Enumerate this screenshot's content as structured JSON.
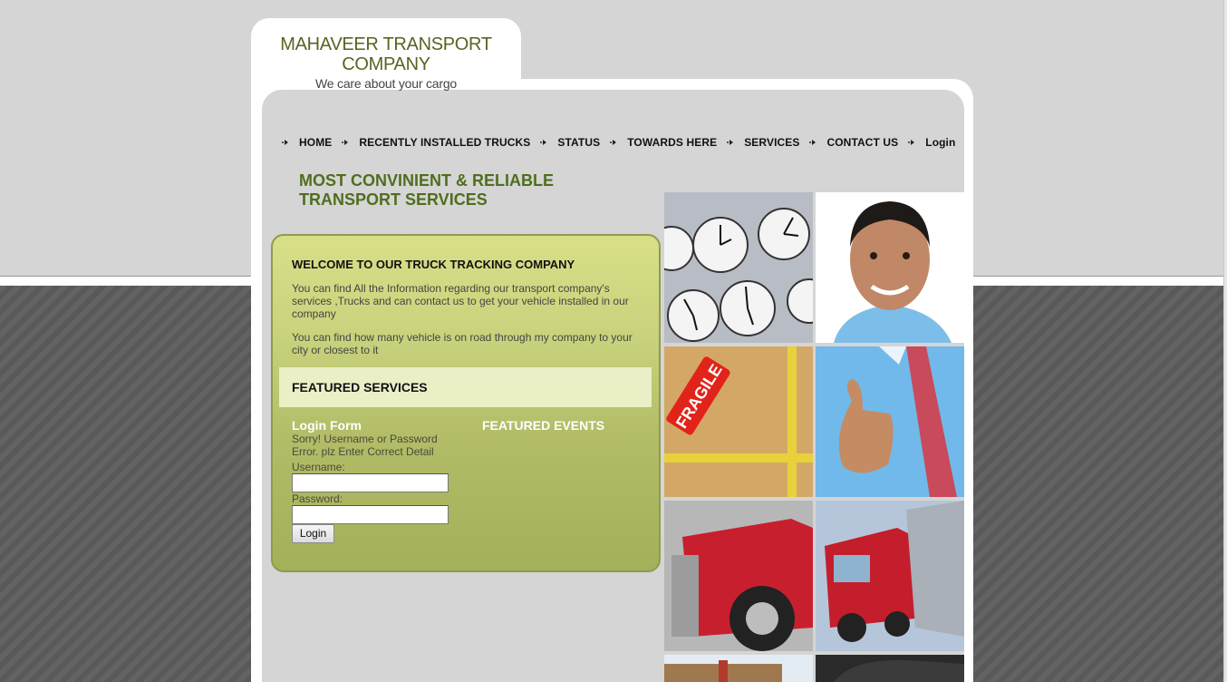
{
  "header": {
    "title": "MAHAVEER TRANSPORT COMPANY",
    "tagline": "We care about your cargo"
  },
  "nav": {
    "items": [
      {
        "label": "HOME"
      },
      {
        "label": "RECENTLY INSTALLED TRUCKS"
      },
      {
        "label": "STATUS"
      },
      {
        "label": "TOWARDS HERE"
      },
      {
        "label": "SERVICES"
      },
      {
        "label": "CONTACT US"
      },
      {
        "label": "Login"
      }
    ]
  },
  "hero": {
    "headline": "MOST CONVINIENT & RELIABLE TRANSPORT SERVICES"
  },
  "welcome": {
    "title": "WELCOME TO OUR TRUCK TRACKING COMPANY",
    "paragraph1": "You can find All the Information regarding our transport company's services ,Trucks and can contact us to get your vehicle installed in our company",
    "paragraph2": "You can find how many vehicle is on road through my company to your city or closest to it"
  },
  "featured": {
    "title": "FEATURED SERVICES"
  },
  "login_form": {
    "title": "Login Form",
    "error": "Sorry! Username or Password Error. plz Enter Correct Detail",
    "username_label": "Username:",
    "password_label": "Password:",
    "username_value": "",
    "password_value": "",
    "submit_label": "Login"
  },
  "events": {
    "title": "FEATURED EVENTS"
  },
  "gallery": {
    "images": [
      "wall-clocks",
      "smiling-man",
      "fragile-box",
      "thumbs-up",
      "red-truck-front",
      "red-truck-side",
      "warehouse",
      "dark-vehicle"
    ]
  },
  "colors": {
    "headline": "#4f6e1d",
    "panel_top": "#d8df88",
    "panel_bottom": "#a4b05a",
    "featured_bar": "#eaefc6"
  }
}
